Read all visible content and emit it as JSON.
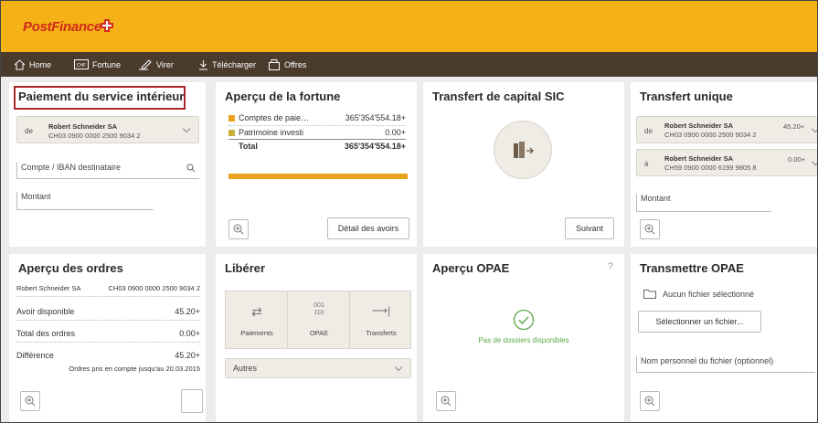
{
  "header": {
    "logo": "PostFinance"
  },
  "nav": [
    {
      "label": "Home",
      "icon": "home-icon"
    },
    {
      "label": "Fortune",
      "icon": "chf-bill-icon"
    },
    {
      "label": "Virer",
      "icon": "pen-icon"
    },
    {
      "label": "Télécharger",
      "icon": "download-icon"
    },
    {
      "label": "Offres",
      "icon": "offer-icon"
    }
  ],
  "paiement": {
    "title": "Paiement du service intérieur",
    "from_label": "de",
    "from_name": "Robert Schneider SA",
    "from_iban": "CH03 0900 0000 2500 9034 2",
    "dest_placeholder": "Compte / IBAN destinataire",
    "amount_placeholder": "Montant"
  },
  "fortune": {
    "title": "Aperçu de la fortune",
    "rows": [
      {
        "label": "Comptes de paie…",
        "value": "365'354'554.18+",
        "color": "#e8a21c"
      },
      {
        "label": "Patrimoine investi",
        "value": "0.00+",
        "color": "#c9b23a"
      }
    ],
    "total_label": "Total",
    "total_value": "365'354'554.18+",
    "detail_button": "Détail des avoirs"
  },
  "sic": {
    "title": "Transfert de capital SIC",
    "next_button": "Suivant"
  },
  "unique": {
    "title": "Transfert unique",
    "from_label": "de",
    "from_name": "Robert Schneider SA",
    "from_iban": "CH03 0900 0000 2500 9034 2",
    "from_amount": "45.20+",
    "to_label": "à",
    "to_name": "Robert Schneider SA",
    "to_iban": "CH59 0900 0000 6199 9805 8",
    "to_amount": "0.00+",
    "amount_placeholder": "Montant"
  },
  "ordres": {
    "title": "Aperçu des ordres",
    "account_name": "Robert Schneider SA",
    "account_iban": "CH03 0900 0000 2500 9034 2",
    "rows": [
      {
        "label": "Avoir disponible",
        "value": "45.20+"
      },
      {
        "label": "Total des ordres",
        "value": "0.00+"
      },
      {
        "label": "Différence",
        "value": "45.20+"
      }
    ],
    "note": "Ordres pris en compte jusqu'au 20.03.2015"
  },
  "liberer": {
    "title": "Libérer",
    "tiles": [
      {
        "label": "Paiements",
        "glyph": "⇄"
      },
      {
        "label": "OPAE",
        "glyph": "001\n110"
      },
      {
        "label": "Transferts",
        "glyph": "⟶|"
      }
    ],
    "others": "Autres"
  },
  "opae": {
    "title": "Aperçu OPAE",
    "help": "?",
    "empty": "Pas de dossiers disponibles"
  },
  "transmettre": {
    "title": "Transmettre OPAE",
    "no_file": "Aucun fichier sélectionné",
    "select_button": "Sélectionner un fichier...",
    "name_placeholder": "Nom personnel du fichier (optionnel)"
  }
}
